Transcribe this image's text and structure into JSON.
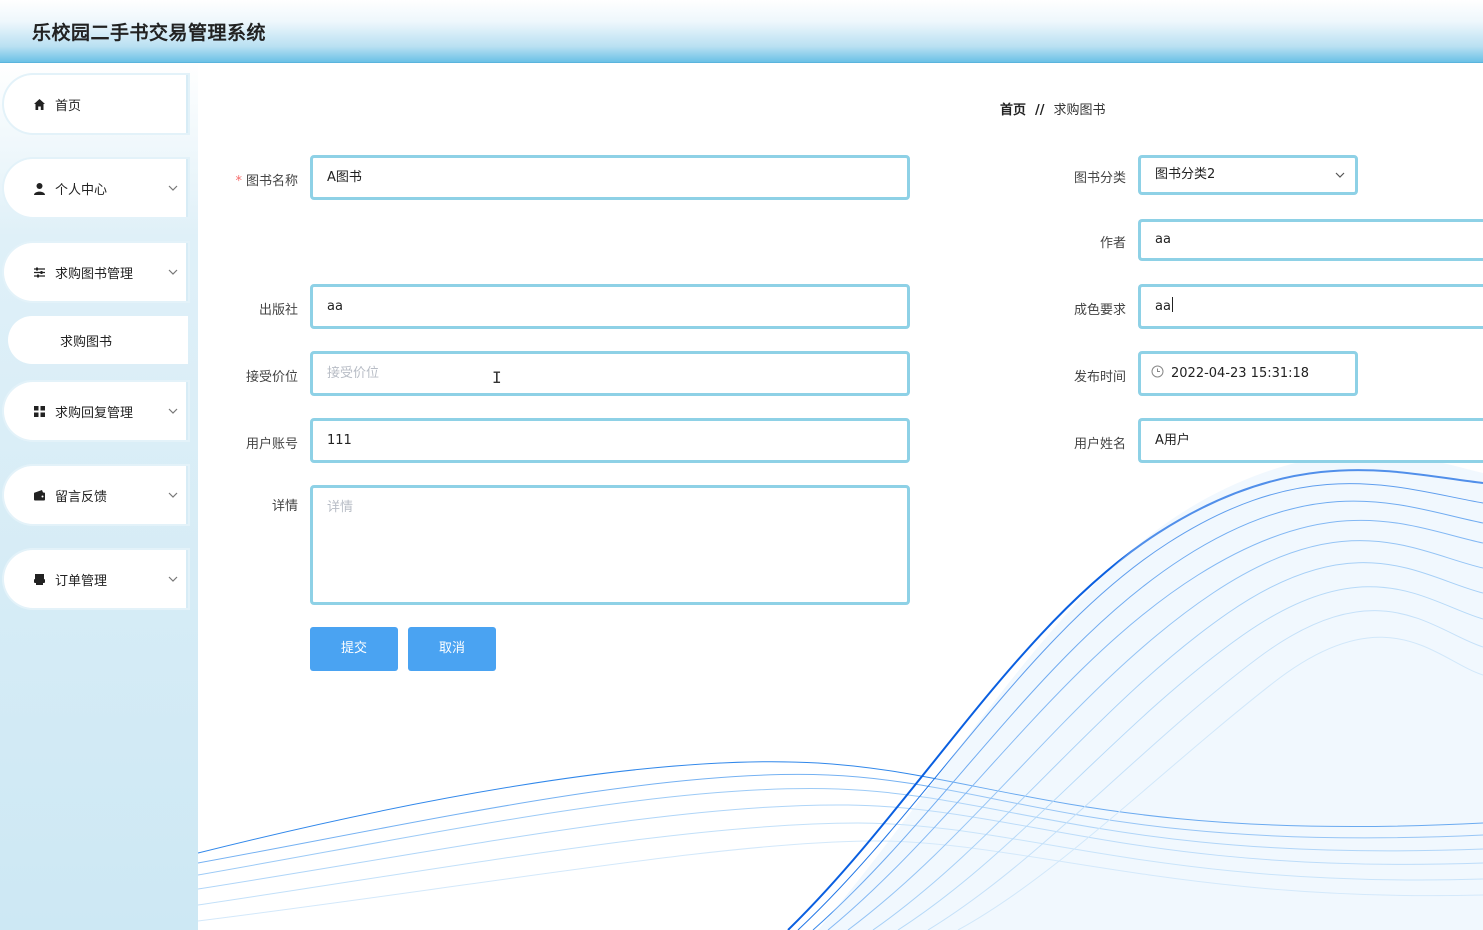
{
  "header": {
    "title": "乐校园二手书交易管理系统"
  },
  "sidebar": {
    "items": [
      {
        "label": "首页",
        "icon": "home-icon"
      },
      {
        "label": "个人中心",
        "icon": "user-icon"
      },
      {
        "label": "求购图书管理",
        "icon": "sliders-icon"
      },
      {
        "label": "求购回复管理",
        "icon": "grid-icon"
      },
      {
        "label": "留言反馈",
        "icon": "wallet-icon"
      },
      {
        "label": "订单管理",
        "icon": "printer-icon"
      }
    ],
    "submenu": {
      "label": "求购图书"
    }
  },
  "breadcrumb": {
    "home": "首页",
    "separator": "//",
    "current": "求购图书"
  },
  "form": {
    "book_name": {
      "label": "图书名称",
      "value": "A图书",
      "required_mark": "*"
    },
    "category": {
      "label": "图书分类",
      "value": "图书分类2"
    },
    "author": {
      "label": "作者",
      "value": "aa"
    },
    "publisher": {
      "label": "出版社",
      "value": "aa"
    },
    "condition": {
      "label": "成色要求",
      "value": "aa"
    },
    "price": {
      "label": "接受价位",
      "placeholder": "接受价位"
    },
    "publish_time": {
      "label": "发布时间",
      "value": "2022-04-23 15:31:18"
    },
    "account": {
      "label": "用户账号",
      "value": "111"
    },
    "username": {
      "label": "用户姓名",
      "value": "A用户"
    },
    "details": {
      "label": "详情",
      "placeholder": "详情"
    },
    "submit_label": "提交",
    "cancel_label": "取消"
  },
  "colors": {
    "accent": "#4aa3f2",
    "field_border": "#8ed1e6",
    "header_bottom": "#6cc1e6"
  }
}
